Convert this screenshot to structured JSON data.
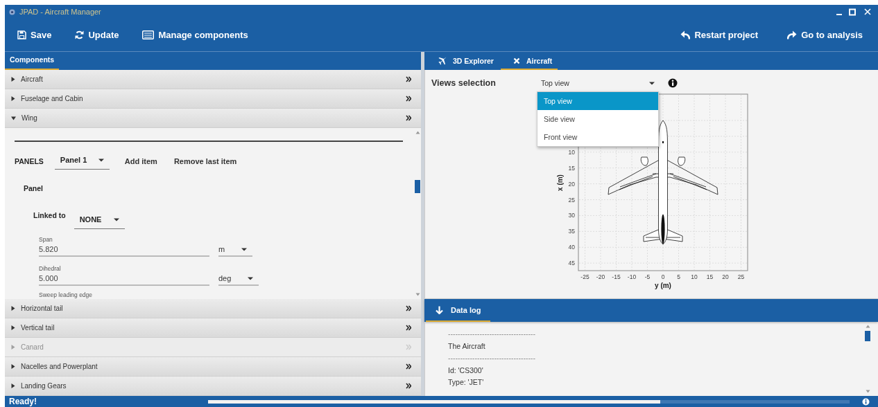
{
  "window": {
    "title": "JPAD - Aircraft Manager"
  },
  "toolbar": {
    "left": [
      {
        "label": "Save",
        "kind": "save"
      },
      {
        "label": "Update",
        "kind": "refresh"
      },
      {
        "label": "Manage components",
        "kind": "list"
      }
    ],
    "right": [
      {
        "label": "Restart project",
        "kind": "undo"
      },
      {
        "label": "Go to analysis",
        "kind": "redo"
      }
    ]
  },
  "components_panel": {
    "tabs": [
      {
        "label": "Components",
        "selected": true
      }
    ],
    "items": [
      {
        "label": "Aircraft",
        "expanded": false,
        "disabled": false
      },
      {
        "label": "Fuselage and Cabin",
        "expanded": false,
        "disabled": false
      },
      {
        "label": "Wing",
        "expanded": true,
        "disabled": false
      },
      {
        "label": "Horizontal tail",
        "expanded": false,
        "disabled": false
      },
      {
        "label": "Vertical tail",
        "expanded": false,
        "disabled": false
      },
      {
        "label": "Canard",
        "expanded": false,
        "disabled": true
      },
      {
        "label": "Nacelles and Powerplant",
        "expanded": false,
        "disabled": false
      },
      {
        "label": "Landing Gears",
        "expanded": false,
        "disabled": false
      }
    ]
  },
  "wing_form": {
    "section_label": "PANELS",
    "panel_select": "Panel 1",
    "buttons": [
      "Add item",
      "Remove last item"
    ],
    "panel_title": "Panel",
    "linked_to": {
      "label": "Linked to",
      "value": "NONE"
    },
    "fields": [
      {
        "label": "Span",
        "value": "5.820",
        "unit": "m"
      },
      {
        "label": "Dihedral",
        "value": "5.000",
        "unit": "deg"
      }
    ],
    "next_field_label": "Sweep leading edge"
  },
  "view_tabs": [
    {
      "label": "3D Explorer",
      "kind": "plane",
      "selected": false
    },
    {
      "label": "Aircraft",
      "kind": "close",
      "selected": true
    }
  ],
  "views": {
    "label": "Views selection",
    "value": "Top view",
    "options": [
      {
        "label": "Top view",
        "selected": true
      },
      {
        "label": "Side view",
        "selected": false
      },
      {
        "label": "Front view",
        "selected": false
      }
    ],
    "plot": {
      "xlabel": "y (m)",
      "ylabel": "x (m)",
      "xticks": [
        "-25",
        "-20",
        "-15",
        "-10",
        "-5",
        "0",
        "5",
        "10",
        "15",
        "20",
        "25"
      ],
      "yticks": [
        "10",
        "15",
        "20",
        "25",
        "30",
        "35",
        "40",
        "45"
      ]
    }
  },
  "data_log": {
    "title": "Data log",
    "lines": [
      "------------------------------------",
      "The Aircraft",
      "------------------------------------",
      "Id: 'CS300'",
      "Type: 'JET'"
    ]
  },
  "status_bar": {
    "text": "Ready!",
    "progress": {
      "level": 0.705
    }
  }
}
